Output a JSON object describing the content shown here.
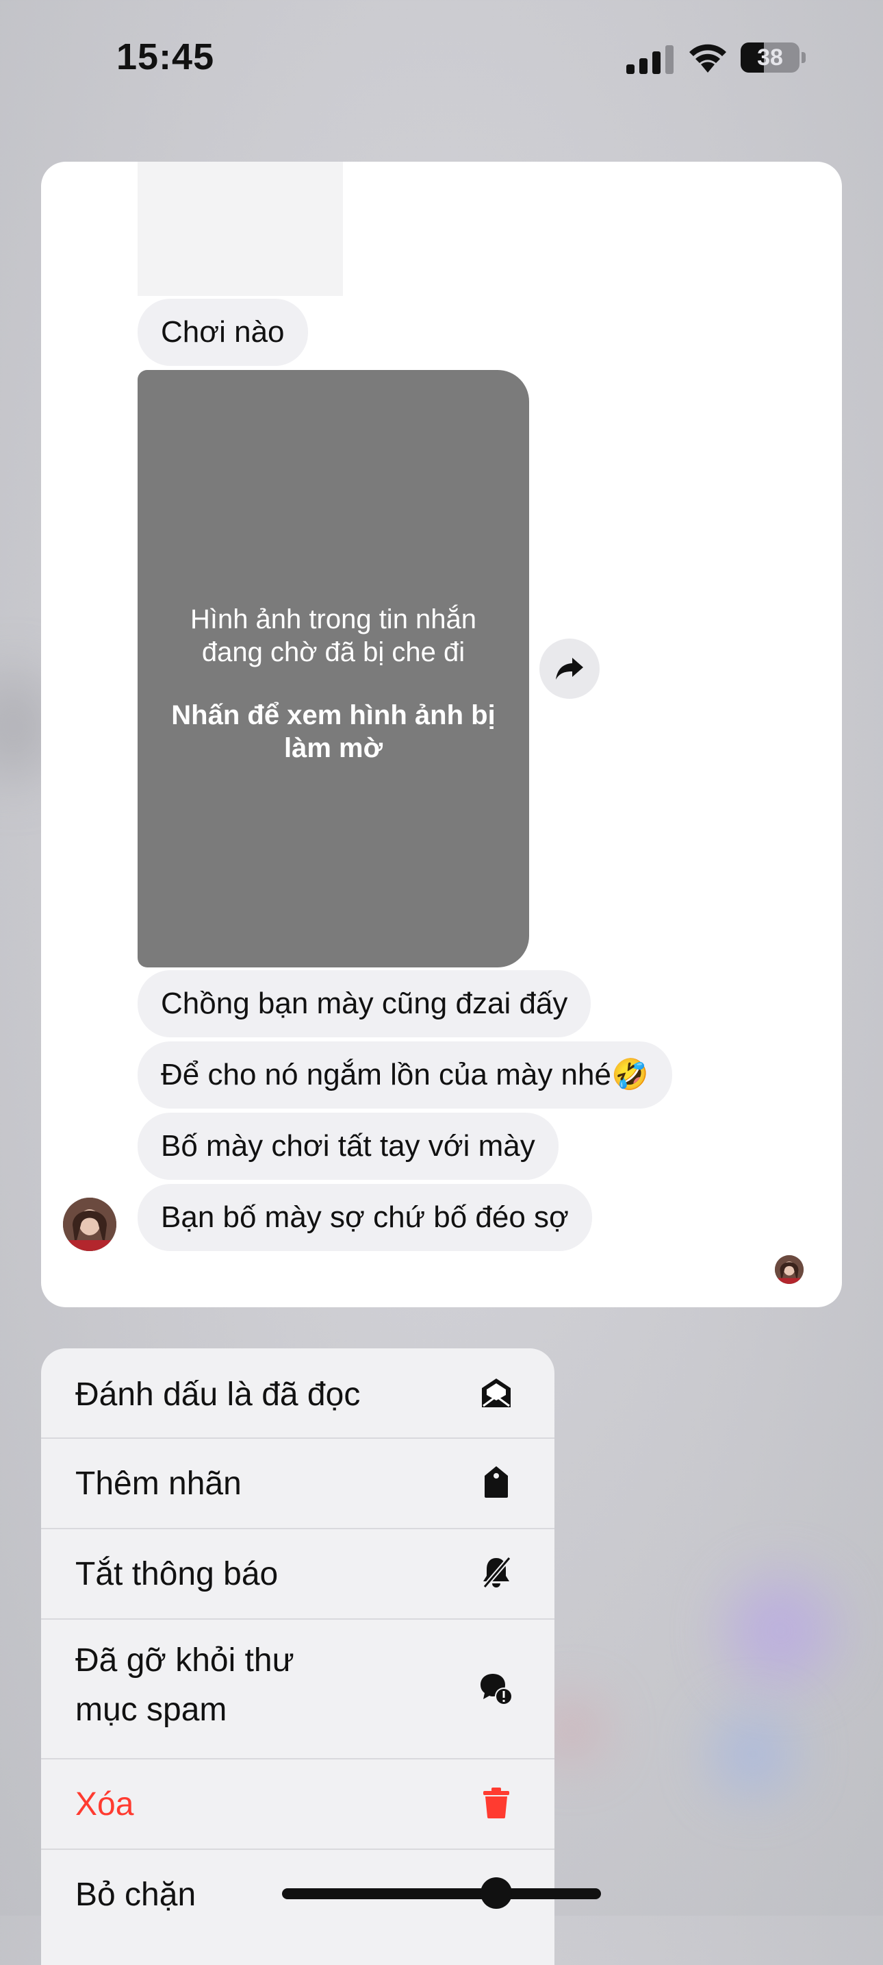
{
  "status_bar": {
    "time": "15:45",
    "battery": "38",
    "icons": [
      "cellular-signal-icon",
      "wifi-icon",
      "battery-icon"
    ]
  },
  "conversation": {
    "messages": [
      {
        "text": "Chơi nào"
      },
      {
        "type": "image",
        "line1": "Hình ảnh trong tin nhắn đang chờ đã bị che đi",
        "line2": "Nhấn để xem hình ảnh bị làm mờ"
      },
      {
        "text": "Chồng bạn mày cũng đzai đấy"
      },
      {
        "text": "Để cho nó ngắm lồn của mày nhé🤣"
      },
      {
        "text": "Bố mày chơi tất tay với mày"
      },
      {
        "text": "Bạn bố mày sợ chứ bố đéo sợ"
      }
    ]
  },
  "menu": {
    "items": [
      {
        "label": "Đánh dấu là đã đọc",
        "icon": "mark-as-read-icon"
      },
      {
        "label": "Thêm nhãn",
        "icon": "tag-icon"
      },
      {
        "label": "Tắt thông báo",
        "icon": "bell-mute-icon"
      },
      {
        "label_line1": "Đã gỡ khỏi thư",
        "label_line2": "mục spam",
        "icon": "chat-alert-icon"
      },
      {
        "label": "Xóa",
        "icon": "trash-icon",
        "color": "#ff3b30"
      },
      {
        "label": "Bỏ chặn",
        "icon": "unblock-icon"
      }
    ]
  }
}
